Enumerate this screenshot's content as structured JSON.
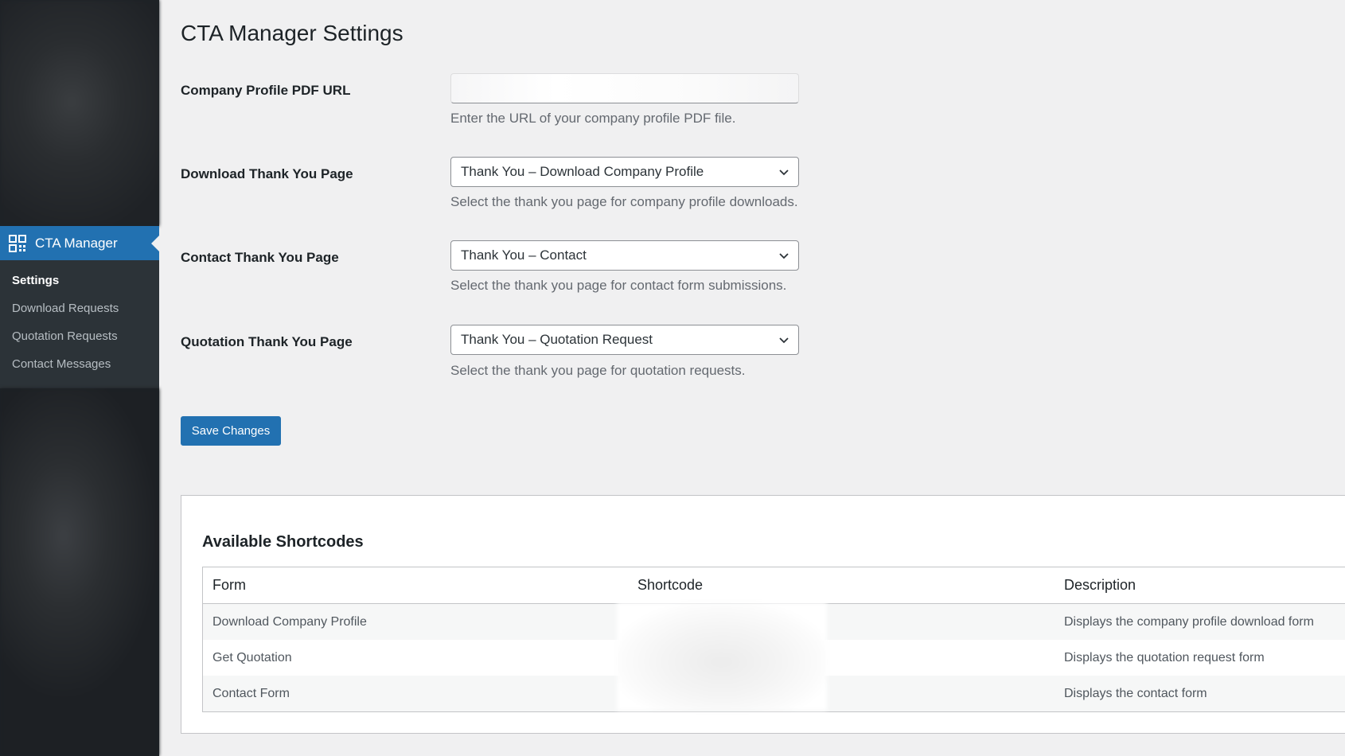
{
  "sidebar": {
    "active_menu": "CTA Manager",
    "submenu": [
      "Settings",
      "Download Requests",
      "Quotation Requests",
      "Contact Messages"
    ]
  },
  "page": {
    "title": "CTA Manager Settings"
  },
  "fields": {
    "pdf_url": {
      "label": "Company Profile PDF URL",
      "value": "",
      "description": "Enter the URL of your company profile PDF file."
    },
    "download_page": {
      "label": "Download Thank You Page",
      "selected": "Thank You – Download Company Profile",
      "description": "Select the thank you page for company profile downloads."
    },
    "contact_page": {
      "label": "Contact Thank You Page",
      "selected": "Thank You – Contact",
      "description": "Select the thank you page for contact form submissions."
    },
    "quotation_page": {
      "label": "Quotation Thank You Page",
      "selected": "Thank You – Quotation Request",
      "description": "Select the thank you page for quotation requests."
    }
  },
  "save_label": "Save Changes",
  "shortcodes": {
    "title": "Available Shortcodes",
    "columns": [
      "Form",
      "Shortcode",
      "Description"
    ],
    "rows": [
      {
        "form": "Download Company Profile",
        "shortcode": "",
        "description": "Displays the company profile download form"
      },
      {
        "form": "Get Quotation",
        "shortcode": "",
        "description": "Displays the quotation request form"
      },
      {
        "form": "Contact Form",
        "shortcode": "",
        "description": "Displays the contact form"
      }
    ]
  },
  "colors": {
    "accent": "#2271b1",
    "sidebar_bg": "#1d2327",
    "page_bg": "#f0f0f1"
  },
  "icons": {
    "menu": "grid-icon",
    "select_arrow": "chevron-down-icon"
  }
}
